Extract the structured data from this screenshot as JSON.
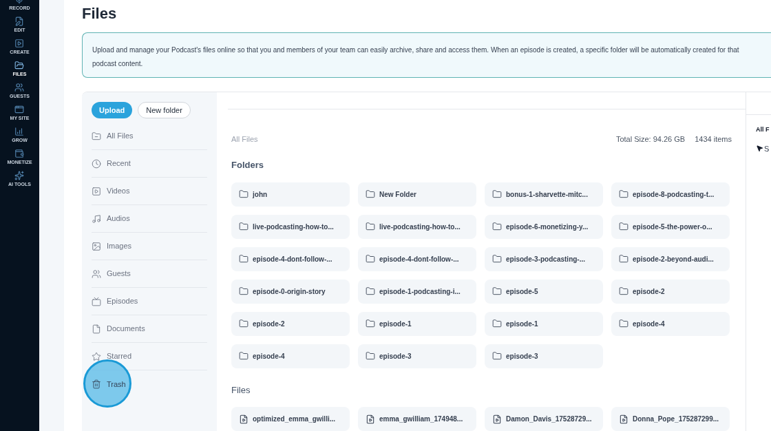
{
  "nav": [
    {
      "label": "RECORD"
    },
    {
      "label": "EDIT"
    },
    {
      "label": "CREATE"
    },
    {
      "label": "FILES",
      "selected": true
    },
    {
      "label": "GUESTS",
      "selected": false
    },
    {
      "label": "MY SITE",
      "selected": false
    },
    {
      "label": "GROW",
      "selected": false
    },
    {
      "label": "MONETIZE",
      "selected": false
    },
    {
      "label": "AI TOOLS",
      "selected": false
    }
  ],
  "title": "Files",
  "info": [
    "Upload and manage your Podcast's files online so that you and members of your team can easily archive, share and access them. When an episode is created, a specific folder will be automatically created for that",
    "podcast content."
  ],
  "buttons": {
    "upload": "Upload",
    "new_folder": "New folder"
  },
  "sidebar": [
    {
      "label": "All Files",
      "clicked": false
    },
    {
      "label": "Recent",
      "clicked": false
    },
    {
      "label": "Videos",
      "clicked": false
    },
    {
      "label": "Audios",
      "clicked": false
    },
    {
      "label": "Images",
      "clicked": false
    },
    {
      "label": "Guests",
      "clicked": false
    },
    {
      "label": "Episodes",
      "clicked": false
    },
    {
      "label": "Documents",
      "clicked": false
    },
    {
      "label": "Starred",
      "clicked": false
    },
    {
      "label": "Trash",
      "clicked": true
    }
  ],
  "breadcrumb": "All Files",
  "total_size": "Total Size: 94.26 GB",
  "item_count": "1434 items",
  "folders_heading": "Folders",
  "folders": [
    "john",
    "New Folder",
    "bonus-1-sharvette-mitc...",
    "episode-8-podcasting-t...",
    "live-podcasting-how-to...",
    "live-podcasting-how-to...",
    "episode-6-monetizing-y...",
    "episode-5-the-power-o...",
    "episode-4-dont-follow-...",
    "episode-4-dont-follow-...",
    "episode-3-podcasting-...",
    "episode-2-beyond-audi...",
    "episode-0-origin-story",
    "episode-1-podcasting-i...",
    "episode-5",
    "episode-2",
    "episode-2",
    "episode-1",
    "episode-1",
    "episode-4",
    "episode-4",
    "episode-3",
    "episode-3"
  ],
  "files_heading": "Files",
  "files": [
    "optimized_emma_gwilli...",
    "emma_gwilliam_174948...",
    "Damon_Davis_17528729...",
    "Donna_Pope_175287299..."
  ],
  "right_pane": {
    "heading": "All F",
    "item": "S"
  }
}
